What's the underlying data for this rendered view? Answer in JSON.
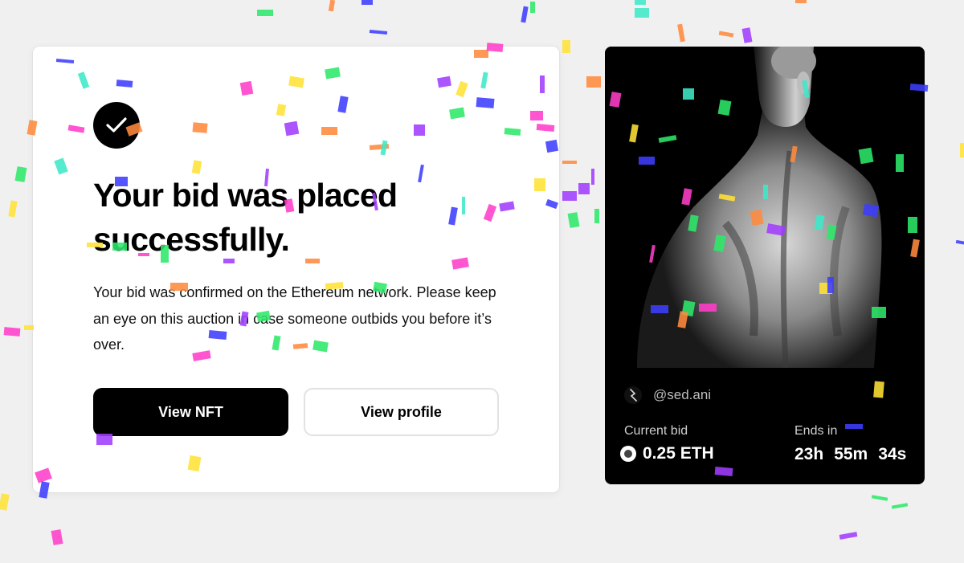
{
  "success": {
    "headline": "Your bid was placed successfully.",
    "description": "Your bid was confirmed on the Ethereum network. Please keep an eye on this auction in case someone outbids you before it’s over.",
    "primary_button": "View NFT",
    "secondary_button": "View profile"
  },
  "nft": {
    "creator": "@sed.ani",
    "current_bid_label": "Current bid",
    "current_bid_value": "0.25 ETH",
    "ends_label": "Ends in",
    "countdown": {
      "hours": "23h",
      "minutes": "55m",
      "seconds": "34s"
    }
  },
  "colors": {
    "confetti": [
      "#ff3ec9",
      "#ff8a3d",
      "#2ee86a",
      "#ffe135",
      "#3d3dff",
      "#a03dff",
      "#3de8c8",
      "#ff5a8c"
    ]
  }
}
